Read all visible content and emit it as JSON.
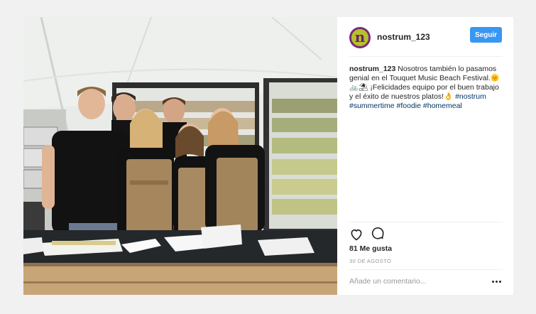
{
  "post": {
    "username": "nostrum_123",
    "avatar_letter": "n",
    "follow_label": "Seguir",
    "caption": {
      "user": "nostrum_123",
      "text_line1": " Nosotros también lo pasamos genial en el Touquet Music Beach Festival.",
      "emoji1": "🌞",
      "emoji_row": "🚲⛱",
      "text_line2": " ¡Felicidades equipo por el buen trabajo y el éxito de nuestros platos!",
      "emoji2": "👌",
      "hashtags": [
        "#nostrum",
        "#summertime",
        "#foodie",
        "#homemeal"
      ]
    },
    "actions": {
      "like_icon": "heart-icon",
      "comment_icon": "comment-icon"
    },
    "likes": "81 Me gusta",
    "date": "30 DE AGOSTO",
    "comment_placeholder": "Añade un comentario...",
    "more_icon": "ellipsis-icon"
  },
  "colors": {
    "follow_button": "#3897f0",
    "hashtag": "#003569",
    "muted": "#999999"
  }
}
